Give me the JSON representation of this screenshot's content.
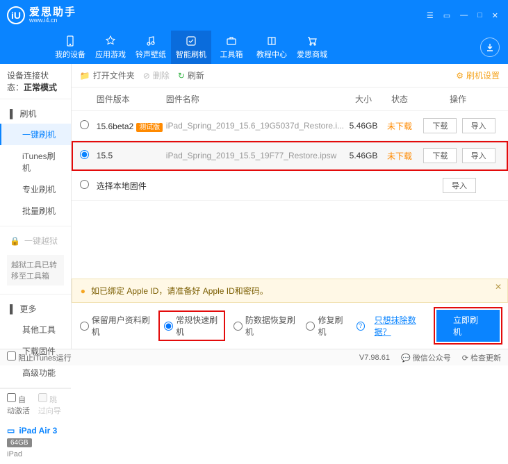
{
  "brand": {
    "name": "爱思助手",
    "url": "www.i4.cn",
    "logo_letter": "iU"
  },
  "nav": {
    "items": [
      {
        "label": "我的设备"
      },
      {
        "label": "应用游戏"
      },
      {
        "label": "铃声壁纸"
      },
      {
        "label": "智能刷机"
      },
      {
        "label": "工具箱"
      },
      {
        "label": "教程中心"
      },
      {
        "label": "爱思商城"
      }
    ],
    "active": 3
  },
  "sidebar": {
    "status_prefix": "设备连接状态：",
    "status_value": "正常模式",
    "group_flash": "刷机",
    "flash_items": [
      "一键刷机",
      "iTunes刷机",
      "专业刷机",
      "批量刷机"
    ],
    "flash_active": 0,
    "group_jb": "一键越狱",
    "jb_note": "越狱工具已转移至工具箱",
    "group_more": "更多",
    "more_items": [
      "其他工具",
      "下载固件",
      "高级功能"
    ],
    "chk_auto": "自动激活",
    "chk_skip": "跳过向导",
    "device_name": "iPad Air 3",
    "device_storage": "64GB",
    "device_type": "iPad"
  },
  "toolbar": {
    "open_folder": "打开文件夹",
    "delete": "删除",
    "refresh": "刷新",
    "settings": "刷机设置"
  },
  "table": {
    "headers": {
      "ver": "固件版本",
      "name": "固件名称",
      "size": "大小",
      "state": "状态",
      "ops": "操作"
    },
    "rows": [
      {
        "ver": "15.6beta2",
        "beta_tag": "测试版",
        "name": "iPad_Spring_2019_15.6_19G5037d_Restore.i...",
        "size": "5.46GB",
        "state": "未下载",
        "selected": false,
        "hl": false
      },
      {
        "ver": "15.5",
        "beta_tag": "",
        "name": "iPad_Spring_2019_15.5_19F77_Restore.ipsw",
        "size": "5.46GB",
        "state": "未下载",
        "selected": true,
        "hl": true
      }
    ],
    "local_row": "选择本地固件",
    "btn_download": "下载",
    "btn_import": "导入"
  },
  "banner": {
    "text": "如已绑定 Apple ID，请准备好 Apple ID和密码。"
  },
  "options": {
    "keep_data": "保留用户资料刷机",
    "normal": "常规快速刷机",
    "antirecovery": "防数据恢复刷机",
    "repair": "修复刷机",
    "exclude_link": "只想抹除数据？",
    "go_btn": "立即刷机",
    "selected": "normal"
  },
  "statusbar": {
    "block_itunes": "阻止iTunes运行",
    "version": "V7.98.61",
    "wechat": "微信公众号",
    "check_update": "检查更新"
  }
}
